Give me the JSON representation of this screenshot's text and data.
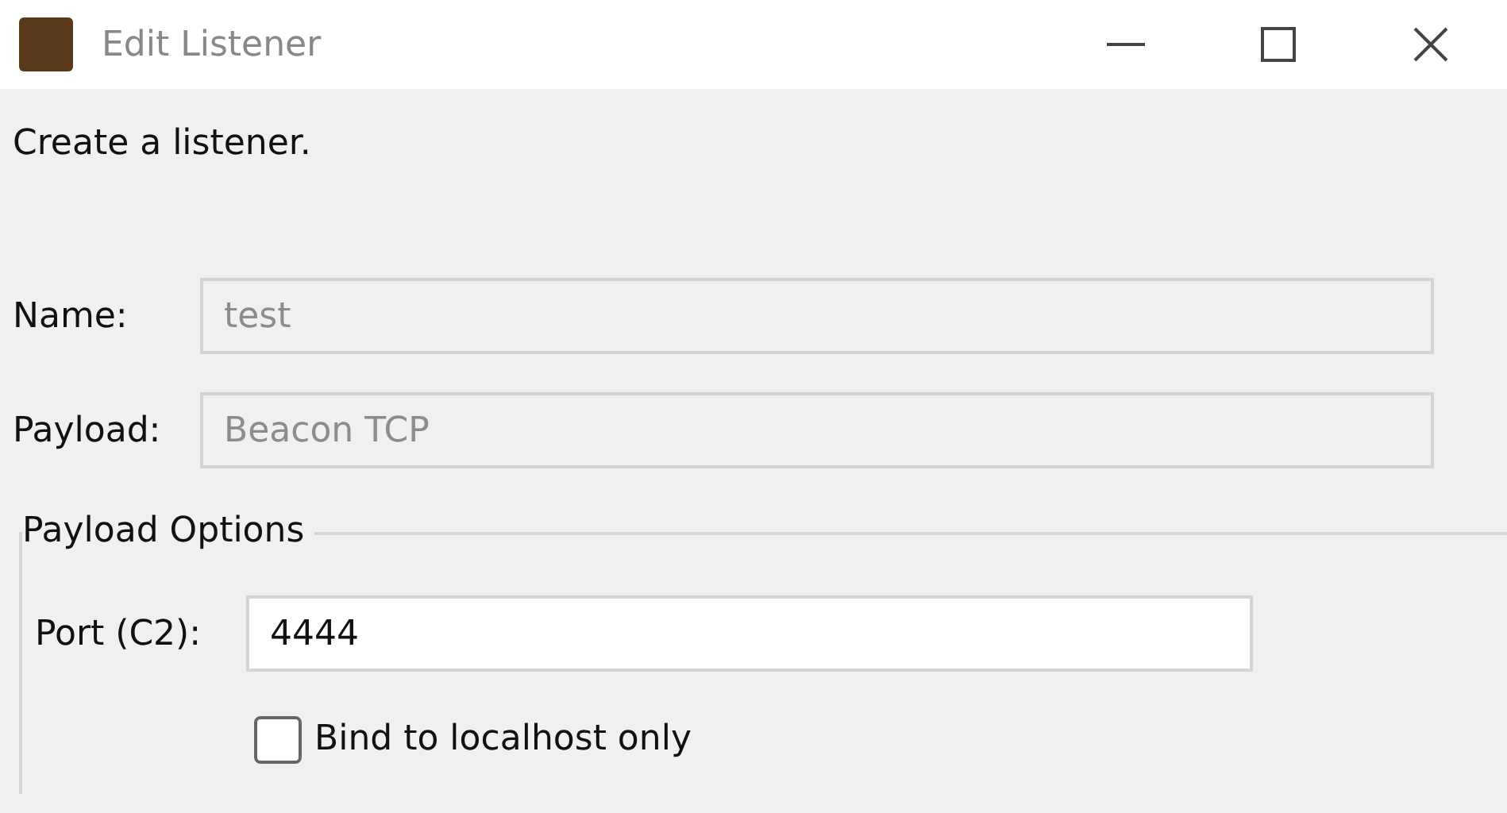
{
  "window": {
    "title": "Edit Listener"
  },
  "description": "Create a listener.",
  "fields": [
    {
      "label": "Name:",
      "value": "test",
      "disabled": true
    },
    {
      "label": "Payload:",
      "value": "Beacon TCP",
      "disabled": true
    }
  ],
  "payload_options": {
    "title": "Payload Options",
    "fields": [
      {
        "label": "Port (C2):",
        "value": "4444",
        "disabled": false
      }
    ],
    "checkbox": {
      "label": "Bind to localhost only",
      "checked": false
    }
  }
}
